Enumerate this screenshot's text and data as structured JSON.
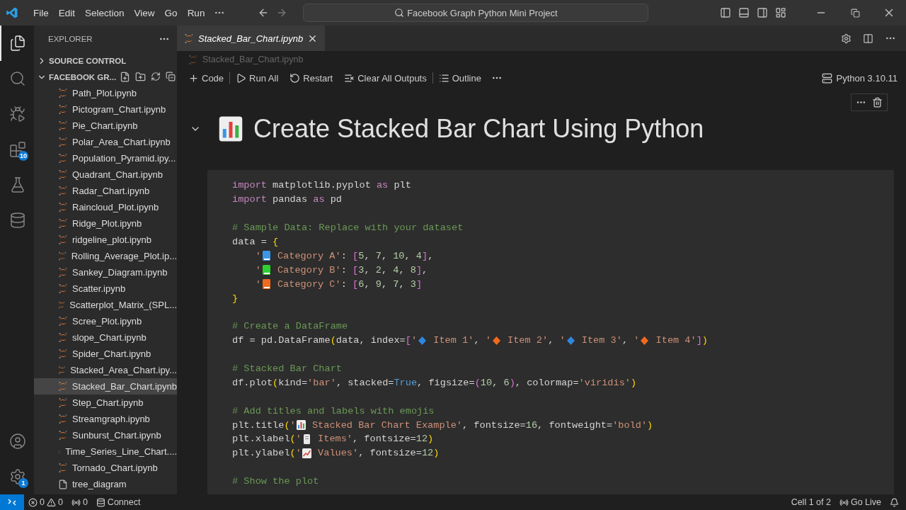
{
  "title_bar": {
    "menu": [
      "File",
      "Edit",
      "Selection",
      "View",
      "Go",
      "Run"
    ],
    "search": "Facebook Graph Python Mini Project"
  },
  "activity_bar": {
    "top": [
      {
        "kind": "explorer",
        "selected": true
      },
      {
        "kind": "search",
        "selected": false
      },
      {
        "kind": "debug",
        "selected": false
      },
      {
        "kind": "extensions",
        "selected": false,
        "badge": "10"
      },
      {
        "kind": "testing",
        "selected": false
      },
      {
        "kind": "database",
        "selected": false
      }
    ],
    "bottom": [
      {
        "kind": "account",
        "selected": false
      },
      {
        "kind": "settings",
        "selected": false,
        "badge": "1"
      }
    ]
  },
  "sidebar": {
    "title": "EXPLORER",
    "sections": [
      {
        "label": "SOURCE CONTROL",
        "expanded": false
      },
      {
        "label": "FACEBOOK GR...",
        "expanded": true
      }
    ],
    "items": [
      {
        "name": "Path_Plot.ipynb",
        "kind": "notebook",
        "selected": false
      },
      {
        "name": "Pictogram_Chart.ipynb",
        "kind": "notebook",
        "selected": false
      },
      {
        "name": "Pie_Chart.ipynb",
        "kind": "notebook",
        "selected": false
      },
      {
        "name": "Polar_Area_Chart.ipynb",
        "kind": "notebook",
        "selected": false
      },
      {
        "name": "Population_Pyramid.ipy...",
        "kind": "notebook",
        "selected": false
      },
      {
        "name": "Quadrant_Chart.ipynb",
        "kind": "notebook",
        "selected": false
      },
      {
        "name": "Radar_Chart.ipynb",
        "kind": "notebook",
        "selected": false
      },
      {
        "name": "Raincloud_Plot.ipynb",
        "kind": "notebook",
        "selected": false
      },
      {
        "name": "Ridge_Plot.ipynb",
        "kind": "notebook",
        "selected": false
      },
      {
        "name": "ridgeline_plot.ipynb",
        "kind": "notebook",
        "selected": false
      },
      {
        "name": "Rolling_Average_Plot.ip...",
        "kind": "notebook",
        "selected": false
      },
      {
        "name": "Sankey_Diagram.ipynb",
        "kind": "notebook",
        "selected": false
      },
      {
        "name": "Scatter.ipynb",
        "kind": "notebook",
        "selected": false
      },
      {
        "name": "Scatterplot_Matrix_(SPL...",
        "kind": "notebook",
        "selected": false
      },
      {
        "name": "Scree_Plot.ipynb",
        "kind": "notebook",
        "selected": false
      },
      {
        "name": "slope_Chart.ipynb",
        "kind": "notebook",
        "selected": false
      },
      {
        "name": "Spider_Chart.ipynb",
        "kind": "notebook",
        "selected": false
      },
      {
        "name": "Stacked_Area_Chart.ipy...",
        "kind": "notebook",
        "selected": false
      },
      {
        "name": "Stacked_Bar_Chart.ipynb",
        "kind": "notebook",
        "selected": true
      },
      {
        "name": "Step_Chart.ipynb",
        "kind": "notebook",
        "selected": false
      },
      {
        "name": "Streamgraph.ipynb",
        "kind": "notebook",
        "selected": false
      },
      {
        "name": "Sunburst_Chart.ipynb",
        "kind": "notebook",
        "selected": false
      },
      {
        "name": "Time_Series_Line_Chart....",
        "kind": "notebook",
        "selected": false
      },
      {
        "name": "Tornado_Chart.ipynb",
        "kind": "notebook",
        "selected": false
      },
      {
        "name": "tree_diagram",
        "kind": "file",
        "selected": false
      }
    ]
  },
  "tabs": [
    {
      "label": "Stacked_Bar_Chart.ipynb",
      "selected": true
    }
  ],
  "breadcrumb": "Stacked_Bar_Chart.ipynb",
  "toolbar": {
    "actions": [
      {
        "kind": "add",
        "label": "Code"
      },
      {
        "kind": "run",
        "label": "Run All"
      },
      {
        "kind": "restart",
        "label": "Restart"
      },
      {
        "kind": "clear",
        "label": "Clear All Outputs"
      },
      {
        "kind": "outline",
        "label": "Outline"
      }
    ],
    "kernel": "Python 3.10.11"
  },
  "markdown_cell": {
    "heading": "Create Stacked Bar Chart Using Python",
    "expanded": true
  },
  "code_lines": [
    {
      "kind": "code",
      "tokens": [
        {
          "kind": "keyword",
          "text": "import"
        },
        {
          "kind": "plain",
          "text": " matplotlib.pyplot "
        },
        {
          "kind": "keyword",
          "text": "as"
        },
        {
          "kind": "plain",
          "text": " plt"
        }
      ]
    },
    {
      "kind": "code",
      "tokens": [
        {
          "kind": "keyword",
          "text": "import"
        },
        {
          "kind": "plain",
          "text": " pandas "
        },
        {
          "kind": "keyword",
          "text": "as"
        },
        {
          "kind": "plain",
          "text": " pd"
        }
      ]
    },
    {
      "kind": "blank"
    },
    {
      "kind": "code",
      "tokens": [
        {
          "kind": "comment",
          "text": "# Sample Data: Replace with your dataset"
        }
      ]
    },
    {
      "kind": "code",
      "tokens": [
        {
          "kind": "plain",
          "text": "data = "
        },
        {
          "kind": "brace",
          "text": "{"
        }
      ]
    },
    {
      "kind": "code",
      "tokens": [
        {
          "kind": "string",
          "text": "    '"
        },
        {
          "kind": "book",
          "color": "#3a96e6"
        },
        {
          "kind": "string",
          "text": " Category A'"
        },
        {
          "kind": "plain",
          "text": ": "
        },
        {
          "kind": "bracket",
          "text": "["
        },
        {
          "kind": "number",
          "text": "5"
        },
        {
          "kind": "plain",
          "text": ", "
        },
        {
          "kind": "number",
          "text": "7"
        },
        {
          "kind": "plain",
          "text": ", "
        },
        {
          "kind": "number",
          "text": "10"
        },
        {
          "kind": "plain",
          "text": ", "
        },
        {
          "kind": "number",
          "text": "4"
        },
        {
          "kind": "bracket",
          "text": "]"
        },
        {
          "kind": "plain",
          "text": ","
        }
      ]
    },
    {
      "kind": "code",
      "tokens": [
        {
          "kind": "string",
          "text": "    '"
        },
        {
          "kind": "book",
          "color": "#2ed12e"
        },
        {
          "kind": "string",
          "text": " Category B'"
        },
        {
          "kind": "plain",
          "text": ": "
        },
        {
          "kind": "bracket",
          "text": "["
        },
        {
          "kind": "number",
          "text": "3"
        },
        {
          "kind": "plain",
          "text": ", "
        },
        {
          "kind": "number",
          "text": "2"
        },
        {
          "kind": "plain",
          "text": ", "
        },
        {
          "kind": "number",
          "text": "4"
        },
        {
          "kind": "plain",
          "text": ", "
        },
        {
          "kind": "number",
          "text": "8"
        },
        {
          "kind": "bracket",
          "text": "]"
        },
        {
          "kind": "plain",
          "text": ","
        }
      ]
    },
    {
      "kind": "code",
      "tokens": [
        {
          "kind": "string",
          "text": "    '"
        },
        {
          "kind": "book",
          "color": "#f06a1e"
        },
        {
          "kind": "string",
          "text": " Category C'"
        },
        {
          "kind": "plain",
          "text": ": "
        },
        {
          "kind": "bracket",
          "text": "["
        },
        {
          "kind": "number",
          "text": "6"
        },
        {
          "kind": "plain",
          "text": ", "
        },
        {
          "kind": "number",
          "text": "9"
        },
        {
          "kind": "plain",
          "text": ", "
        },
        {
          "kind": "number",
          "text": "7"
        },
        {
          "kind": "plain",
          "text": ", "
        },
        {
          "kind": "number",
          "text": "3"
        },
        {
          "kind": "bracket",
          "text": "]"
        }
      ]
    },
    {
      "kind": "code",
      "tokens": [
        {
          "kind": "brace",
          "text": "}"
        }
      ]
    },
    {
      "kind": "blank"
    },
    {
      "kind": "code",
      "tokens": [
        {
          "kind": "comment",
          "text": "# Create a DataFrame"
        }
      ]
    },
    {
      "kind": "code",
      "tokens": [
        {
          "kind": "plain",
          "text": "df = pd.DataFrame"
        },
        {
          "kind": "brace",
          "text": "("
        },
        {
          "kind": "plain",
          "text": "data, index="
        },
        {
          "kind": "bracket",
          "text": "["
        },
        {
          "kind": "string",
          "text": "'"
        },
        {
          "kind": "diamond",
          "color": "#2f86e0"
        },
        {
          "kind": "string",
          "text": " Item 1'"
        },
        {
          "kind": "plain",
          "text": ", "
        },
        {
          "kind": "string",
          "text": "'"
        },
        {
          "kind": "diamond",
          "color": "#f06a1e"
        },
        {
          "kind": "string",
          "text": " Item 2'"
        },
        {
          "kind": "plain",
          "text": ", "
        },
        {
          "kind": "string",
          "text": "'"
        },
        {
          "kind": "diamond",
          "color": "#2f86e0"
        },
        {
          "kind": "string",
          "text": " Item 3'"
        },
        {
          "kind": "plain",
          "text": ", "
        },
        {
          "kind": "string",
          "text": "'"
        },
        {
          "kind": "diamond",
          "color": "#f06a1e"
        },
        {
          "kind": "string",
          "text": " Item 4'"
        },
        {
          "kind": "bracket",
          "text": "]"
        },
        {
          "kind": "brace",
          "text": ")"
        }
      ]
    },
    {
      "kind": "blank"
    },
    {
      "kind": "code",
      "tokens": [
        {
          "kind": "comment",
          "text": "# Stacked Bar Chart"
        }
      ]
    },
    {
      "kind": "code",
      "tokens": [
        {
          "kind": "plain",
          "text": "df.plot"
        },
        {
          "kind": "brace",
          "text": "("
        },
        {
          "kind": "plain",
          "text": "kind="
        },
        {
          "kind": "string",
          "text": "'bar'"
        },
        {
          "kind": "plain",
          "text": ", stacked="
        },
        {
          "kind": "bool",
          "text": "True"
        },
        {
          "kind": "plain",
          "text": ", figsize="
        },
        {
          "kind": "bracket",
          "text": "("
        },
        {
          "kind": "number",
          "text": "10"
        },
        {
          "kind": "plain",
          "text": ", "
        },
        {
          "kind": "number",
          "text": "6"
        },
        {
          "kind": "bracket",
          "text": ")"
        },
        {
          "kind": "plain",
          "text": ", colormap="
        },
        {
          "kind": "string",
          "text": "'viridis'"
        },
        {
          "kind": "brace",
          "text": ")"
        }
      ]
    },
    {
      "kind": "blank"
    },
    {
      "kind": "code",
      "tokens": [
        {
          "kind": "comment",
          "text": "# Add titles and labels with emojis"
        }
      ]
    },
    {
      "kind": "code",
      "tokens": [
        {
          "kind": "plain",
          "text": "plt.title"
        },
        {
          "kind": "brace",
          "text": "("
        },
        {
          "kind": "string",
          "text": "'"
        },
        {
          "kind": "bar-chart"
        },
        {
          "kind": "string",
          "text": " Stacked Bar Chart Example'"
        },
        {
          "kind": "plain",
          "text": ", fontsize="
        },
        {
          "kind": "number",
          "text": "16"
        },
        {
          "kind": "plain",
          "text": ", fontweight="
        },
        {
          "kind": "string",
          "text": "'bold'"
        },
        {
          "kind": "brace",
          "text": ")"
        }
      ]
    },
    {
      "kind": "code",
      "tokens": [
        {
          "kind": "plain",
          "text": "plt.xlabel"
        },
        {
          "kind": "brace",
          "text": "("
        },
        {
          "kind": "string",
          "text": "'"
        },
        {
          "kind": "scroll"
        },
        {
          "kind": "string",
          "text": " Items'"
        },
        {
          "kind": "plain",
          "text": ", fontsize="
        },
        {
          "kind": "number",
          "text": "12"
        },
        {
          "kind": "brace",
          "text": ")"
        }
      ]
    },
    {
      "kind": "code",
      "tokens": [
        {
          "kind": "plain",
          "text": "plt.ylabel"
        },
        {
          "kind": "brace",
          "text": "("
        },
        {
          "kind": "string",
          "text": "'"
        },
        {
          "kind": "trend-chart"
        },
        {
          "kind": "string",
          "text": " Values'"
        },
        {
          "kind": "plain",
          "text": ", fontsize="
        },
        {
          "kind": "number",
          "text": "12"
        },
        {
          "kind": "brace",
          "text": ")"
        }
      ]
    },
    {
      "kind": "blank"
    },
    {
      "kind": "code",
      "tokens": [
        {
          "kind": "comment",
          "text": "# Show the plot"
        }
      ]
    }
  ],
  "status_bar": {
    "errors": "0",
    "warnings": "0",
    "ports": "0",
    "connect": "Connect",
    "cell": "Cell 1 of 2",
    "live": "Go Live"
  }
}
